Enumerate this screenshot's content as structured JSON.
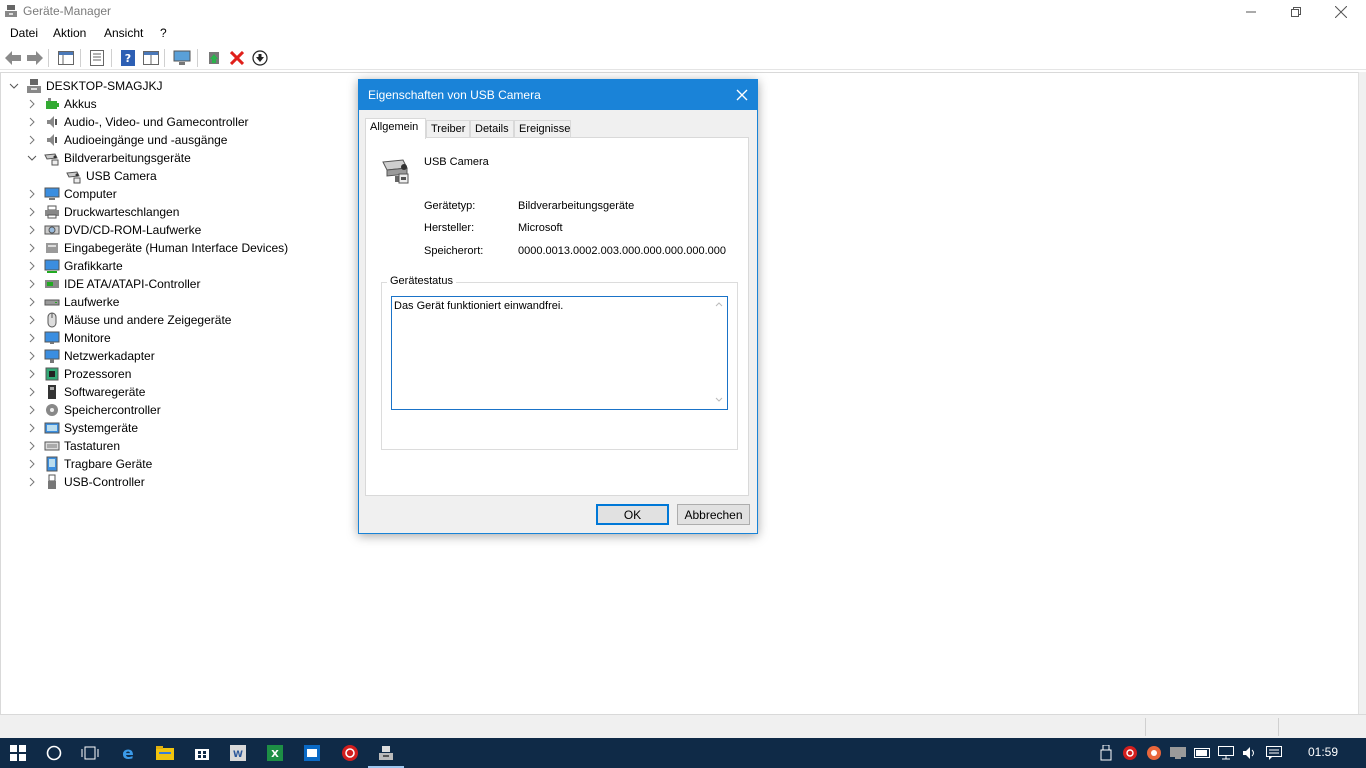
{
  "window": {
    "title": "Geräte-Manager"
  },
  "menu": [
    "Datei",
    "Aktion",
    "Ansicht",
    "?"
  ],
  "toolbar": {
    "icons": [
      "back-arrow-icon",
      "forward-arrow-icon",
      "console-tree-icon",
      "properties-icon",
      "help-icon",
      "show-hidden-icon",
      "scan-hardware-icon",
      "update-driver-icon",
      "uninstall-icon",
      "disable-device-icon"
    ]
  },
  "tree": {
    "root": "DESKTOP-SMAGJKJ",
    "nodes": [
      {
        "label": "Akkus",
        "icon": "battery-icon",
        "expanded": false
      },
      {
        "label": "Audio-, Video- und Gamecontroller",
        "icon": "speaker-icon",
        "expanded": false
      },
      {
        "label": "Audioeingänge und -ausgänge",
        "icon": "speaker-icon",
        "expanded": false
      },
      {
        "label": "Bildverarbeitungsgeräte",
        "icon": "camera-icon",
        "expanded": true
      },
      {
        "label": "USB Camera",
        "icon": "camera-icon",
        "child": true
      },
      {
        "label": "Computer",
        "icon": "computer-icon",
        "expanded": false
      },
      {
        "label": "Druckwarteschlangen",
        "icon": "printer-icon",
        "expanded": false
      },
      {
        "label": "DVD/CD-ROM-Laufwerke",
        "icon": "disc-icon",
        "expanded": false
      },
      {
        "label": "Eingabegeräte (Human Interface Devices)",
        "icon": "hid-icon",
        "expanded": false
      },
      {
        "label": "Grafikkarte",
        "icon": "display-adapter-icon",
        "expanded": false
      },
      {
        "label": "IDE ATA/ATAPI-Controller",
        "icon": "ide-controller-icon",
        "expanded": false
      },
      {
        "label": "Laufwerke",
        "icon": "drive-icon",
        "expanded": false
      },
      {
        "label": "Mäuse und andere Zeigegeräte",
        "icon": "mouse-icon",
        "expanded": false
      },
      {
        "label": "Monitore",
        "icon": "monitor-icon",
        "expanded": false
      },
      {
        "label": "Netzwerkadapter",
        "icon": "network-icon",
        "expanded": false
      },
      {
        "label": "Prozessoren",
        "icon": "processor-icon",
        "expanded": false
      },
      {
        "label": "Softwaregeräte",
        "icon": "software-device-icon",
        "expanded": false
      },
      {
        "label": "Speichercontroller",
        "icon": "storage-controller-icon",
        "expanded": false
      },
      {
        "label": "Systemgeräte",
        "icon": "system-device-icon",
        "expanded": false
      },
      {
        "label": "Tastaturen",
        "icon": "keyboard-icon",
        "expanded": false
      },
      {
        "label": "Tragbare Geräte",
        "icon": "portable-device-icon",
        "expanded": false
      },
      {
        "label": "USB-Controller",
        "icon": "usb-icon",
        "expanded": false
      }
    ]
  },
  "dialog": {
    "title": "Eigenschaften von USB Camera",
    "tabs": [
      "Allgemein",
      "Treiber",
      "Details",
      "Ereignisse"
    ],
    "device_name": "USB Camera",
    "fields": [
      {
        "label": "Gerätetyp:",
        "value": "Bildverarbeitungsgeräte"
      },
      {
        "label": "Hersteller:",
        "value": "Microsoft"
      },
      {
        "label": "Speicherort:",
        "value": "0000.0013.0002.003.000.000.000.000.000"
      }
    ],
    "status_group": "Gerätestatus",
    "status_text": "Das Gerät funktioniert einwandfrei.",
    "ok": "OK",
    "cancel": "Abbrechen"
  },
  "taskbar": {
    "clock": "01:59"
  },
  "colors": {
    "accent": "#1a83d8",
    "taskbar": "#0f2a47"
  }
}
